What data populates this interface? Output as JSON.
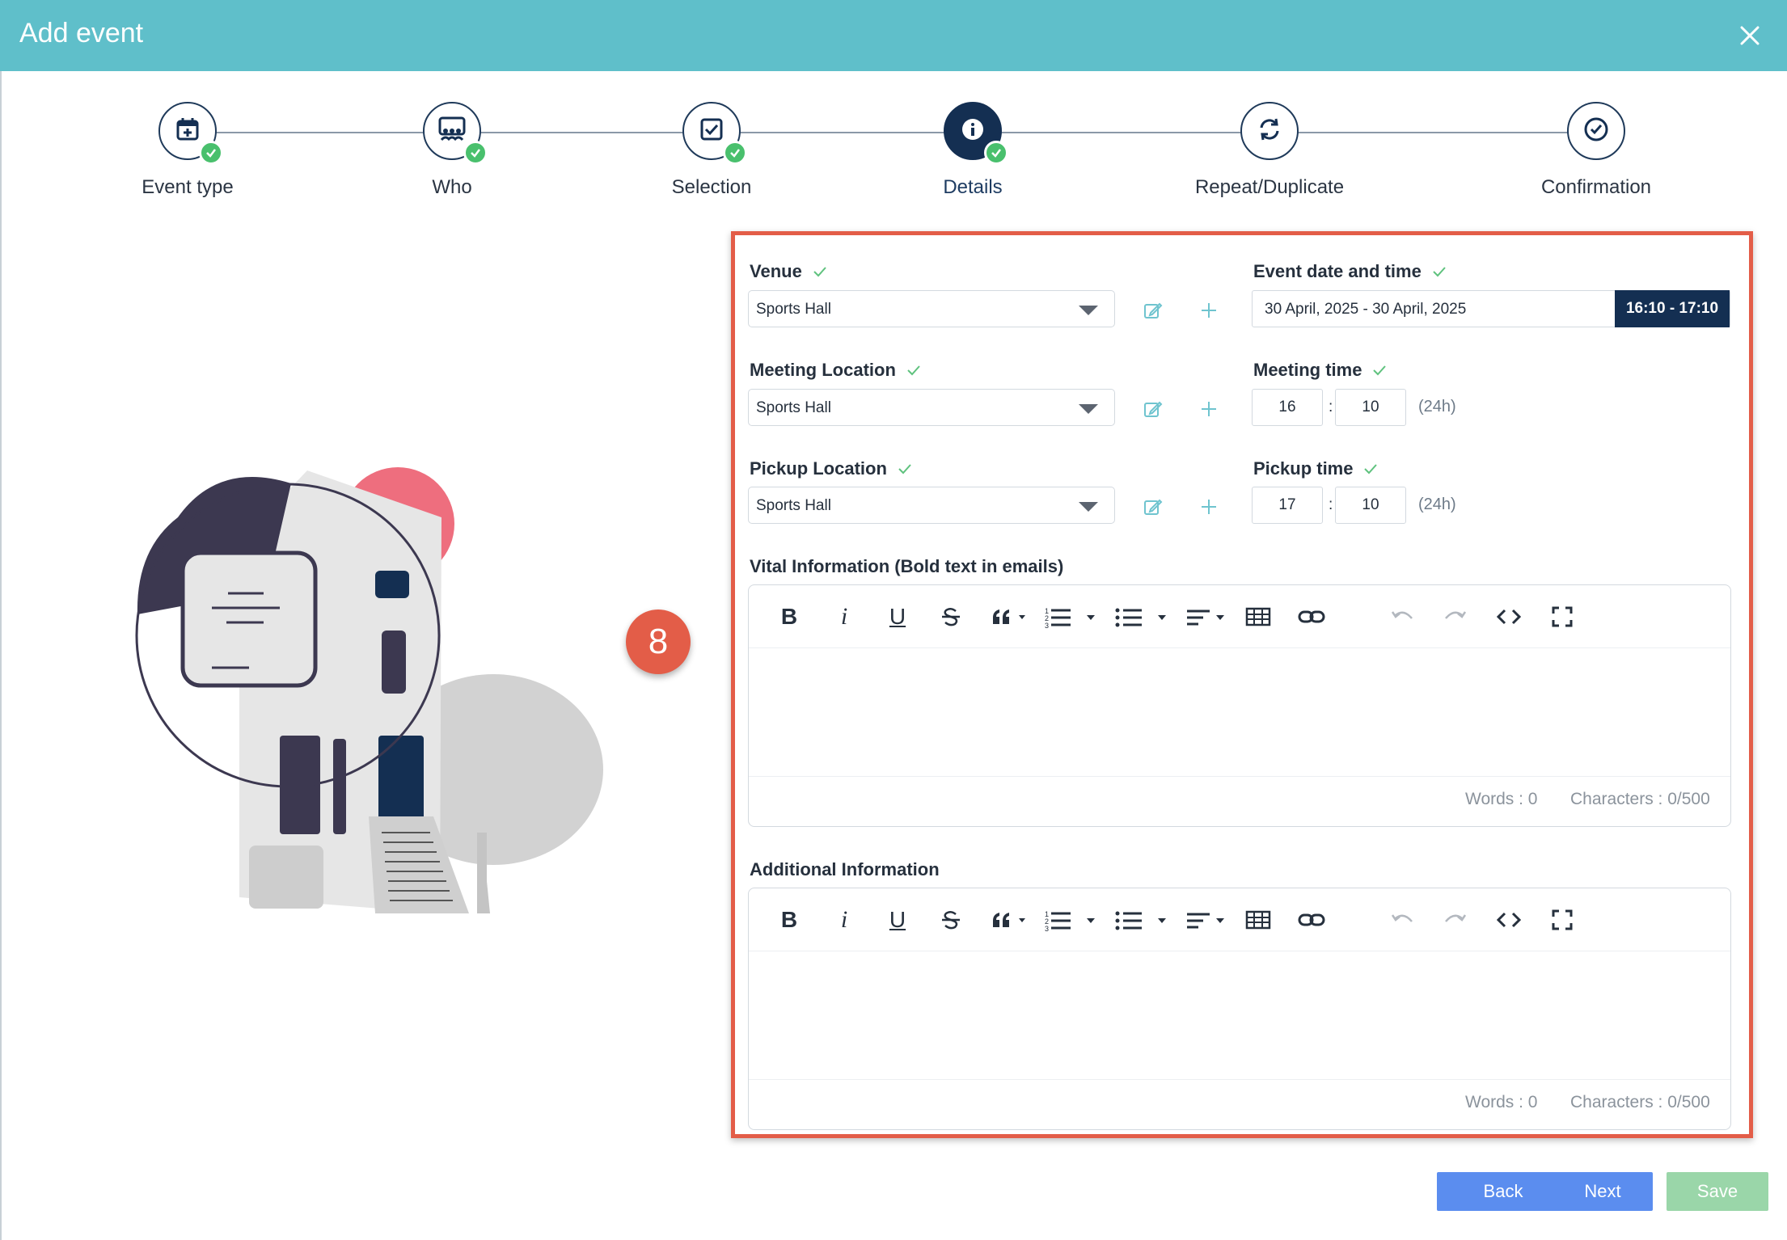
{
  "header": {
    "title": "Add event"
  },
  "steps": [
    {
      "label": "Event type",
      "icon": "calendar-plus-icon",
      "done": true
    },
    {
      "label": "Who",
      "icon": "group-icon",
      "done": true
    },
    {
      "label": "Selection",
      "icon": "checkbox-icon",
      "done": true
    },
    {
      "label": "Details",
      "icon": "info-icon",
      "done": true,
      "active": true
    },
    {
      "label": "Repeat/Duplicate",
      "icon": "refresh-icon",
      "done": false
    },
    {
      "label": "Confirmation",
      "icon": "check-circle-icon",
      "done": false
    }
  ],
  "badge": "8",
  "form": {
    "venue": {
      "label": "Venue",
      "value": "Sports Hall"
    },
    "meeting_location": {
      "label": "Meeting Location",
      "value": "Sports Hall"
    },
    "pickup_location": {
      "label": "Pickup Location",
      "value": "Sports Hall"
    },
    "event_datetime": {
      "label": "Event date and time",
      "date_range": "30 April, 2025 - 30 April, 2025",
      "time_range": "16:10  - 17:10"
    },
    "meeting_time": {
      "label": "Meeting time",
      "hour": "16",
      "minute": "10",
      "separator": ":",
      "hint": "(24h)"
    },
    "pickup_time": {
      "label": "Pickup time",
      "hour": "17",
      "minute": "10",
      "separator": ":",
      "hint": "(24h)"
    },
    "vital_info": {
      "label": "Vital Information (Bold text in emails)",
      "words": "Words : 0",
      "characters": "Characters : 0/500"
    },
    "additional_info": {
      "label": "Additional Information",
      "words": "Words : 0",
      "characters": "Characters : 0/500"
    }
  },
  "toolbar": {
    "bold": "B",
    "italic": "i",
    "underline": "U"
  },
  "buttons": {
    "back": "Back",
    "next": "Next",
    "save": "Save"
  },
  "colors": {
    "header": "#5fbfca",
    "navy": "#142f52",
    "success": "#49c06d",
    "highlight": "#e35d48",
    "primary_button": "#5b8def",
    "disabled_save": "#9ad6a9"
  }
}
